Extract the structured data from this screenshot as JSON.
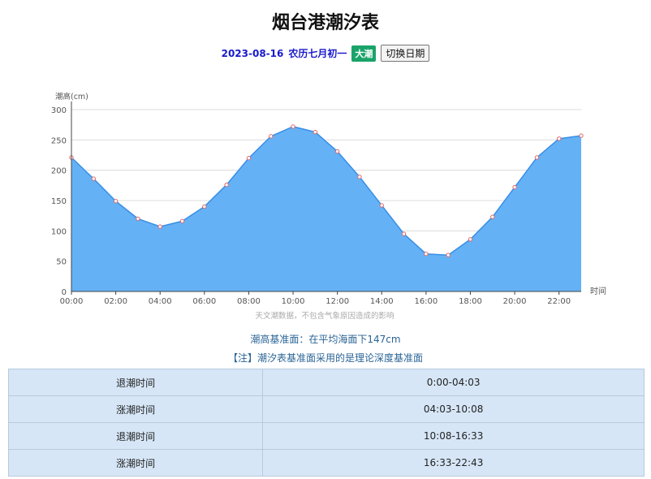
{
  "page": {
    "title": "烟台港潮汐表",
    "date": "2023-08-16",
    "lunar_date": "农历七月初一",
    "tide_badge": "大潮",
    "switch_button": "切换日期",
    "datum_text": "潮高基准面：在平均海面下147cm",
    "note_text": "【注】潮汐表基准面采用的是理论深度基准面"
  },
  "colors": {
    "area_fill": "#64b2f5",
    "line": "#3a8ee6",
    "marker": "#e06666",
    "badge": "#1aa36a",
    "table_bg": "#d6e6f7"
  },
  "chart_data": {
    "type": "area",
    "ylabel": "潮高(cm)",
    "xlabel": "时间",
    "subtitle": "天文潮数据，不包含气象原因造成的影响",
    "ylim": [
      0,
      300
    ],
    "yticks": [
      0,
      50,
      100,
      150,
      200,
      250,
      300
    ],
    "xticks": [
      "00:00",
      "02:00",
      "04:00",
      "06:00",
      "08:00",
      "10:00",
      "12:00",
      "14:00",
      "16:00",
      "18:00",
      "20:00",
      "22:00"
    ],
    "grid": true,
    "x": [
      0,
      1,
      2,
      3,
      4,
      5,
      6,
      7,
      8,
      9,
      10,
      11,
      12,
      13,
      14,
      15,
      16,
      17,
      18,
      19,
      20,
      21,
      22,
      23
    ],
    "values": [
      221,
      186,
      149,
      120,
      107,
      116,
      140,
      176,
      220,
      256,
      272,
      263,
      231,
      189,
      142,
      95,
      62,
      60,
      86,
      123,
      172,
      221,
      252,
      257
    ]
  },
  "tide_table": [
    {
      "label": "退潮时间",
      "time": "0:00-04:03"
    },
    {
      "label": "涨潮时间",
      "time": "04:03-10:08"
    },
    {
      "label": "退潮时间",
      "time": "10:08-16:33"
    },
    {
      "label": "涨潮时间",
      "time": "16:33-22:43"
    }
  ]
}
